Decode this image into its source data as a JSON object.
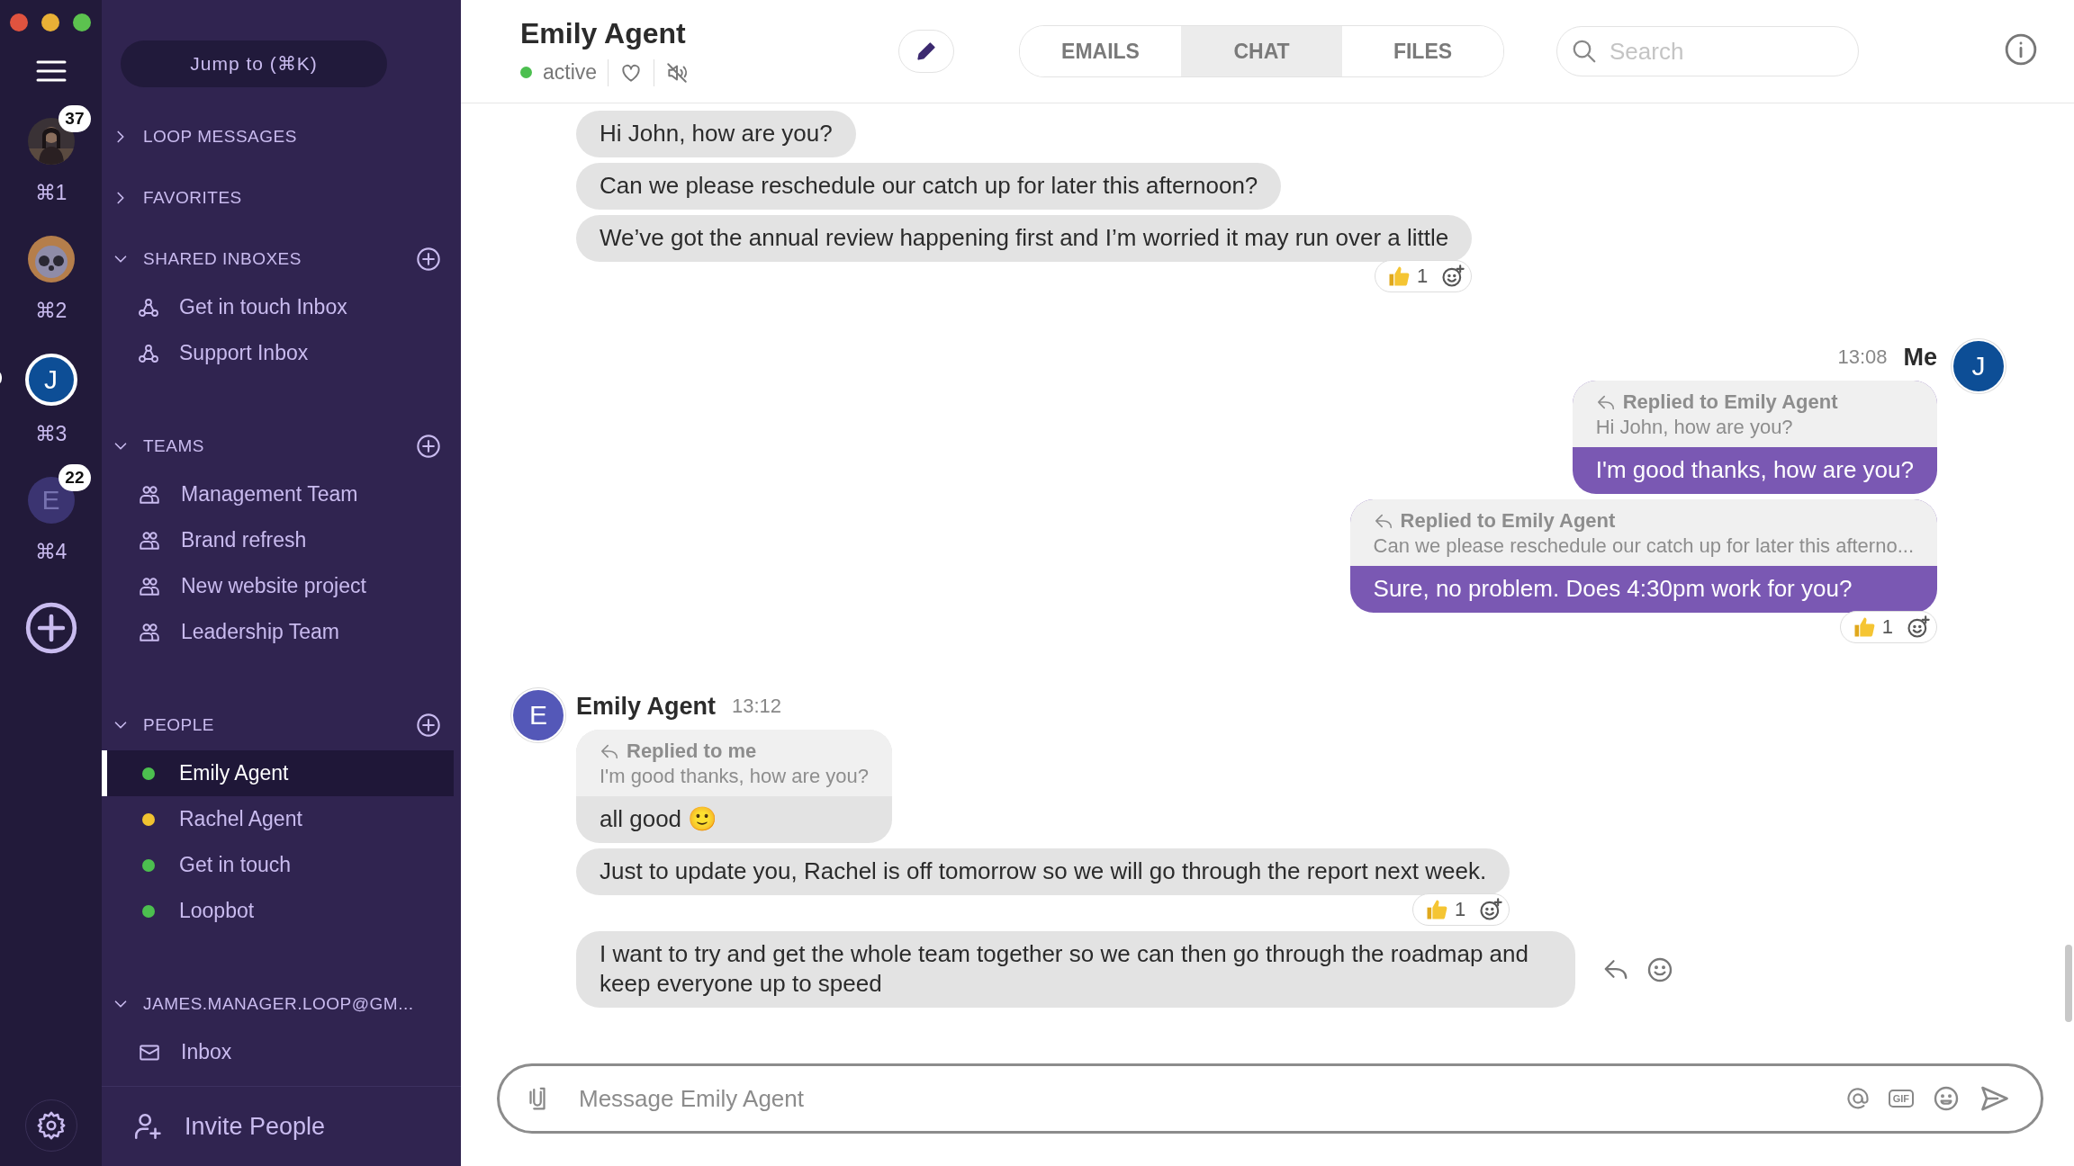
{
  "rail": {
    "items": [
      {
        "kind": "picture",
        "badge": "37",
        "shortcut": "⌘1",
        "selected": false
      },
      {
        "kind": "animal",
        "shortcut": "⌘2",
        "selected": false
      },
      {
        "kind": "initial",
        "initial": "J",
        "shortcut": "⌘3",
        "selected": true
      },
      {
        "kind": "initial",
        "initial": "E",
        "badge": "22",
        "shortcut": "⌘4",
        "selected": false
      }
    ]
  },
  "sidebar": {
    "jump_button": "Jump to (⌘K)",
    "sections": [
      {
        "title": "LOOP MESSAGES",
        "expanded": false,
        "addable": false
      },
      {
        "title": "FAVORITES",
        "expanded": false,
        "addable": false
      },
      {
        "title": "SHARED INBOXES",
        "expanded": true,
        "addable": true,
        "items": [
          {
            "kind": "inbox",
            "label": "Get in touch Inbox",
            "selected": false
          },
          {
            "kind": "inbox",
            "label": "Support Inbox",
            "selected": false
          }
        ]
      },
      {
        "title": "TEAMS",
        "expanded": true,
        "addable": true,
        "items": [
          {
            "kind": "team",
            "label": "Management Team",
            "selected": false
          },
          {
            "kind": "team",
            "label": "Brand refresh",
            "selected": false
          },
          {
            "kind": "team",
            "label": "New website project",
            "selected": false
          },
          {
            "kind": "team",
            "label": "Leadership Team",
            "selected": false
          }
        ]
      },
      {
        "title": "PEOPLE",
        "expanded": true,
        "addable": true,
        "items": [
          {
            "kind": "person",
            "label": "Emily Agent",
            "color": "#4cbf4f",
            "selected": true
          },
          {
            "kind": "person",
            "label": "Rachel Agent",
            "color": "#f0c330",
            "selected": false
          },
          {
            "kind": "person",
            "label": "Get in touch",
            "color": "#4cbf4f",
            "selected": false
          },
          {
            "kind": "person",
            "label": "Loopbot",
            "color": "#4cbf4f",
            "selected": false
          }
        ]
      },
      {
        "title": "JAMES.MANAGER.LOOP@GM...",
        "expanded": true,
        "addable": false,
        "items": [
          {
            "kind": "mail",
            "label": "Inbox",
            "selected": false
          }
        ]
      }
    ],
    "footer_button": "Invite People"
  },
  "header": {
    "title": "Emily Agent",
    "status": "active",
    "online": true,
    "tabs": [
      {
        "label": "EMAILS",
        "selected": false
      },
      {
        "label": "CHAT",
        "selected": true
      },
      {
        "label": "FILES",
        "selected": false
      }
    ],
    "search": {
      "placeholder": "Search"
    }
  },
  "messages": [
    {
      "mine": false,
      "bubbles": [
        {
          "text": "Hi John, how are you?"
        },
        {
          "text": "Can we please reschedule our catch up for later this afternoon?"
        },
        {
          "text": "We’ve got the annual review happening first and I’m worried it may run over a little",
          "reactions": [
            {
              "kind": "thumbs_up",
              "count": "1"
            }
          ]
        }
      ]
    },
    {
      "mine": true,
      "sender": "Me",
      "time": "13:08",
      "avatar": "J",
      "bubbles": [
        {
          "reply_label": "Replied to Emily Agent",
          "quote": "Hi John, how are you?",
          "text": "I'm good thanks, how are you?"
        },
        {
          "reply_label": "Replied to Emily Agent",
          "quote": "Can we please reschedule our catch up for later this afterno...",
          "text": "Sure, no problem. Does 4:30pm work for you?",
          "reactions": [
            {
              "kind": "thumbs_up",
              "count": "1"
            }
          ]
        }
      ]
    },
    {
      "mine": false,
      "sender": "Emily Agent",
      "time": "13:12",
      "avatar": "E",
      "bubbles": [
        {
          "reply_label": "Replied to me",
          "quote": "I'm good thanks, how are you?",
          "text": "all good 🙂"
        },
        {
          "text": "Just to update you, Rachel is off tomorrow so we will go through the report next week.",
          "reactions": [
            {
              "kind": "thumbs_up",
              "count": "1"
            }
          ]
        },
        {
          "text": "I want to try and get the whole team together so we can then go through the roadmap and keep everyone up to speed",
          "hovered": true
        }
      ]
    }
  ],
  "composer": {
    "placeholder": "Message Emily Agent",
    "gif_button": "GIF"
  }
}
